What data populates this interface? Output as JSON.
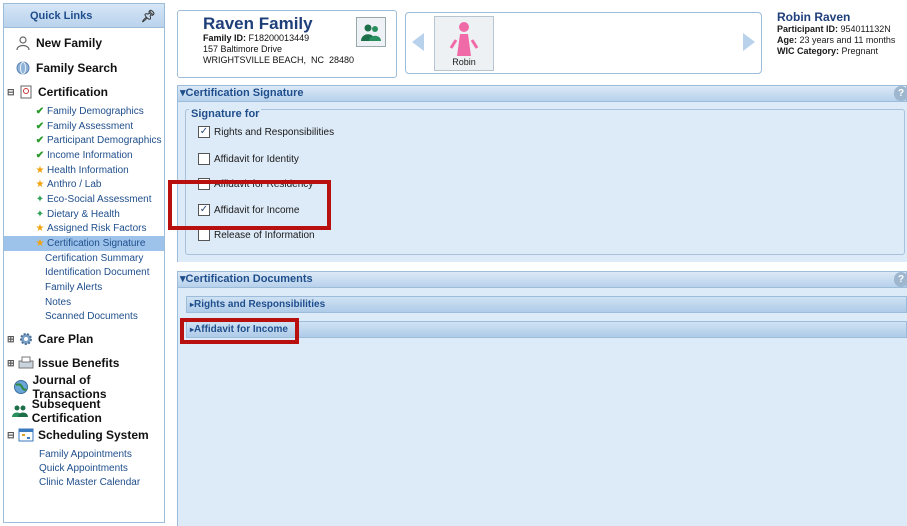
{
  "sidebar": {
    "title": "Quick Links",
    "top_links": [
      {
        "label": "New Family",
        "icon": "person-icon"
      },
      {
        "label": "Family Search",
        "icon": "search-icon"
      }
    ],
    "certification": {
      "label": "Certification",
      "items": [
        {
          "label": "Family Demographics",
          "status": "complete"
        },
        {
          "label": "Family Assessment",
          "status": "complete"
        },
        {
          "label": "Participant Demographics",
          "status": "complete"
        },
        {
          "label": "Income Information",
          "status": "complete"
        },
        {
          "label": "Health Information",
          "status": "required"
        },
        {
          "label": "Anthro / Lab",
          "status": "required"
        },
        {
          "label": "Eco-Social Assessment",
          "status": "optional"
        },
        {
          "label": "Dietary & Health",
          "status": "optional"
        },
        {
          "label": "Assigned Risk Factors",
          "status": "required"
        },
        {
          "label": "Certification Signature",
          "status": "active"
        },
        {
          "label": "Certification Summary",
          "status": "none"
        },
        {
          "label": "Identification Document",
          "status": "none"
        },
        {
          "label": "Family Alerts",
          "status": "none"
        },
        {
          "label": "Notes",
          "status": "none"
        },
        {
          "label": "Scanned Documents",
          "status": "none"
        }
      ]
    },
    "sections": [
      {
        "label": "Care Plan"
      },
      {
        "label": "Issue Benefits"
      },
      {
        "label": "Journal of Transactions"
      },
      {
        "label": "Subsequent Certification"
      }
    ],
    "scheduling": {
      "label": "Scheduling System",
      "items": [
        "Family Appointments",
        "Quick Appointments",
        "Clinic Master Calendar"
      ]
    }
  },
  "family": {
    "name": "Raven Family",
    "id_label": "Family ID:",
    "id_value": "F18200013449",
    "address1": "157 Baltimore Drive",
    "address2": "WRIGHTSVILLE BEACH,  NC  28480"
  },
  "carousel": {
    "member_name": "Robin"
  },
  "participant": {
    "name": "Robin Raven",
    "id_label": "Participant ID:",
    "id_value": "954011132N",
    "age_label": "Age:",
    "age_value": "23 years and 11 months",
    "category_label": "WIC Category:",
    "category_value": "Pregnant"
  },
  "signature_panel": {
    "title": "Certification Signature",
    "legend": "Signature for",
    "items": [
      {
        "label": "Rights and Responsibilities",
        "checked": true
      },
      {
        "label": "Affidavit for Identity",
        "checked": false
      },
      {
        "label": "Affidavit for Residency",
        "checked": false
      },
      {
        "label": "Affidavit for Income",
        "checked": true
      },
      {
        "label": "Release of Information",
        "checked": false
      }
    ]
  },
  "documents_panel": {
    "title": "Certification Documents",
    "items": [
      "Rights and Responsibilities",
      "Affidavit for Income"
    ]
  },
  "colors": {
    "accent": "#1f4e8c",
    "highlight": "#b80f0f",
    "panel_bg": "#ddeaf7"
  }
}
